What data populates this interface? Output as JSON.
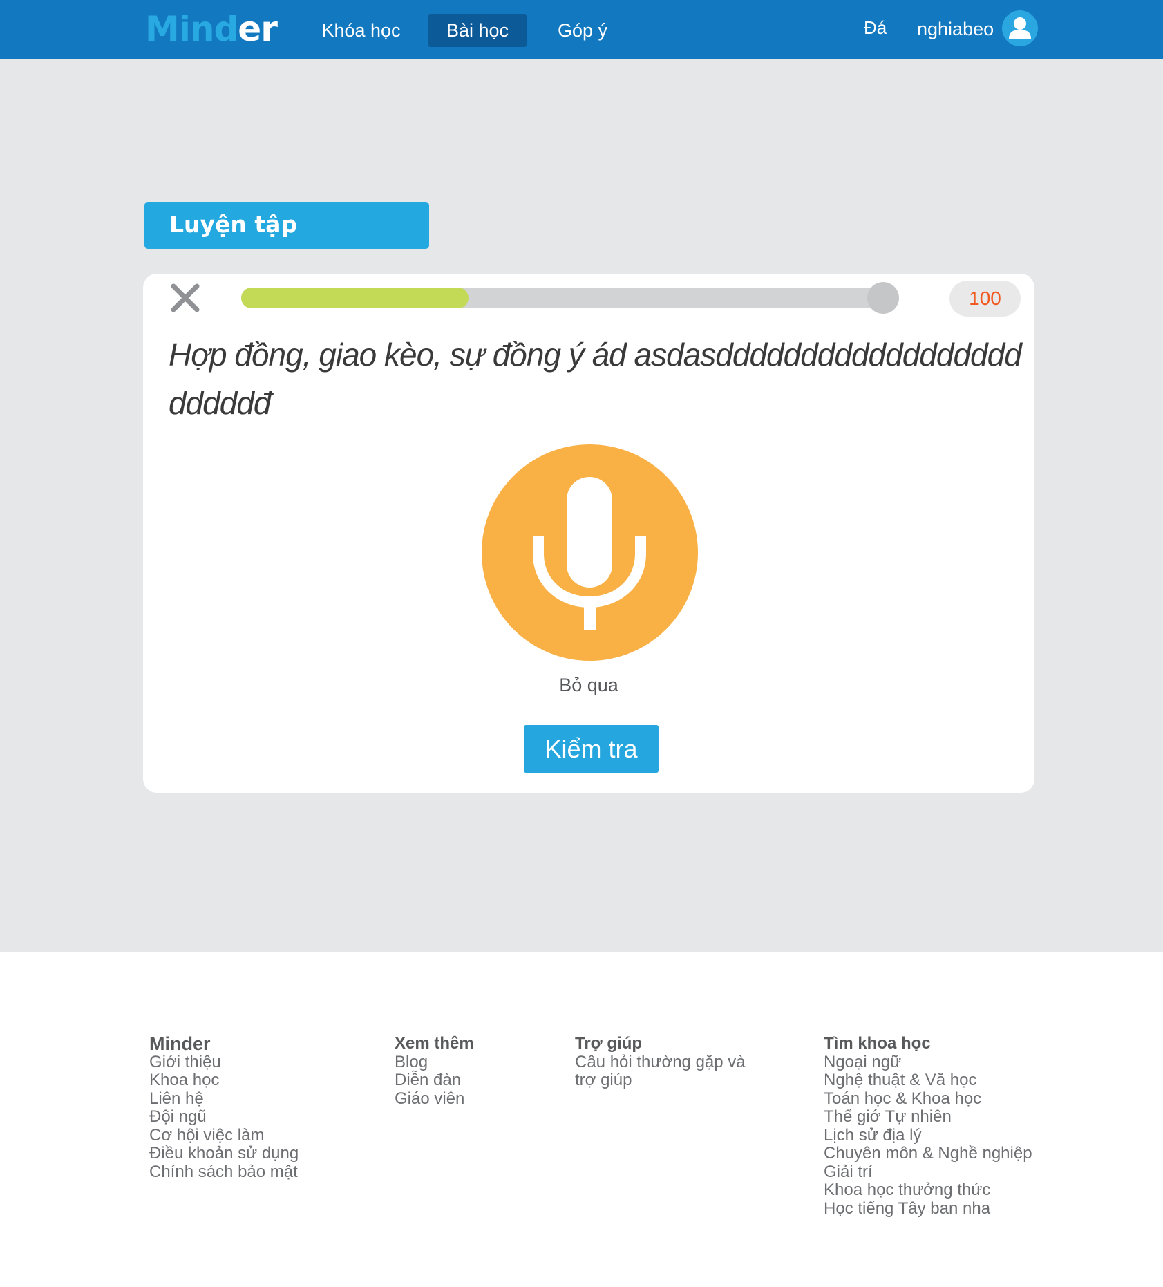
{
  "header": {
    "logo_part1": "Mind",
    "logo_part2": "er",
    "nav": [
      "Khóa học",
      "Bài học",
      "Góp ý"
    ],
    "active_nav": "Bài học",
    "right_link": "Đá",
    "username": "nghiabeo"
  },
  "practice": {
    "title": "Luyện tập",
    "progress": 0.35,
    "score": "100",
    "question": "Hợp đồng, giao kèo, sự đồng ý ád asdasdddddddddddddddddddddddđ",
    "skip_label": "Bỏ qua",
    "check_label": "Kiểm tra"
  },
  "colors": {
    "header": "#1278bf",
    "accent": "#24a8e0",
    "progress_fill": "#c3da57",
    "mic": "#f9b045",
    "score_text": "#f05a22",
    "background": "#e6e7e9"
  },
  "icons": {
    "close": "close-icon",
    "mic": "microphone-icon",
    "user": "user-icon"
  },
  "footer": {
    "columns": [
      {
        "heading": "Minder",
        "items": [
          "Giới thiệu",
          "Khoa học",
          "Liên hệ",
          "Đội ngũ",
          "Cơ hội việc làm",
          "Điều khoản sử dụng",
          "Chính sách bảo mật"
        ]
      },
      {
        "heading": "Xem thêm",
        "items": [
          "Blog",
          "Diễn đàn",
          "Giáo viên"
        ]
      },
      {
        "heading": "Trợ giúp",
        "items": [
          "Câu hỏi thường gặp và trợ giúp"
        ]
      },
      {
        "heading": "Tìm khoa học",
        "items": [
          "Ngoại ngữ",
          "Nghệ thuật & Vă học",
          "Toán học & Khoa học",
          "Thế giớ Tự nhiên",
          "Lịch sử địa lý",
          "Chuyên môn & Nghề nghiệp",
          "Giải trí",
          "Khoa học thưởng thức",
          "Học tiếng Tây ban nha"
        ]
      }
    ]
  }
}
